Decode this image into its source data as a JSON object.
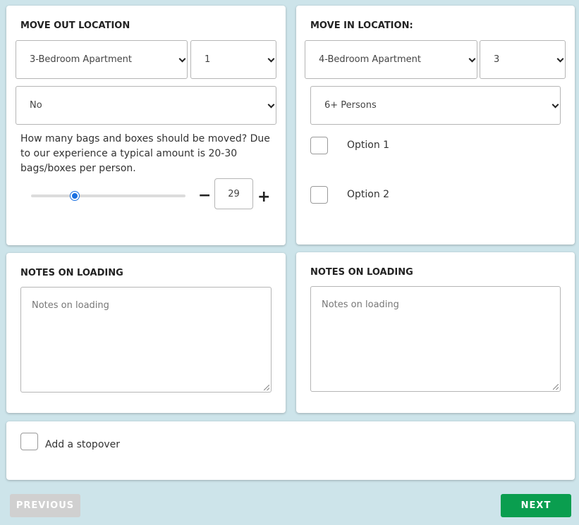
{
  "move_out": {
    "title": "MOVE OUT LOCATION",
    "property_type": "3-Bedroom Apartment",
    "floor": "1",
    "elevator": "No",
    "bags_question": "How many bags and boxes should be moved? Due to our experience a typical amount is 20-30 bags/boxes per person.",
    "bags_count": "29",
    "bags_slider_fraction": 0.29,
    "minus_label": "−",
    "plus_label": "+"
  },
  "move_in": {
    "title": "MOVE IN LOCATION:",
    "property_type": "4-Bedroom Apartment",
    "floor": "3",
    "persons": "6+ Persons",
    "option1_label": "Option 1",
    "option2_label": "Option 2"
  },
  "notes_out": {
    "title": "NOTES ON LOADING",
    "placeholder": "Notes on loading"
  },
  "notes_in": {
    "title": "NOTES ON LOADING",
    "placeholder": "Notes on loading"
  },
  "stopover": {
    "label": "Add a stopover"
  },
  "nav": {
    "previous_label": "PREVIOUS",
    "next_label": "NEXT"
  },
  "colors": {
    "background": "#cde4ea",
    "next_button": "#0a9e4f",
    "previous_button": "#d0d0d0",
    "slider_thumb": "#1a6fe0"
  }
}
